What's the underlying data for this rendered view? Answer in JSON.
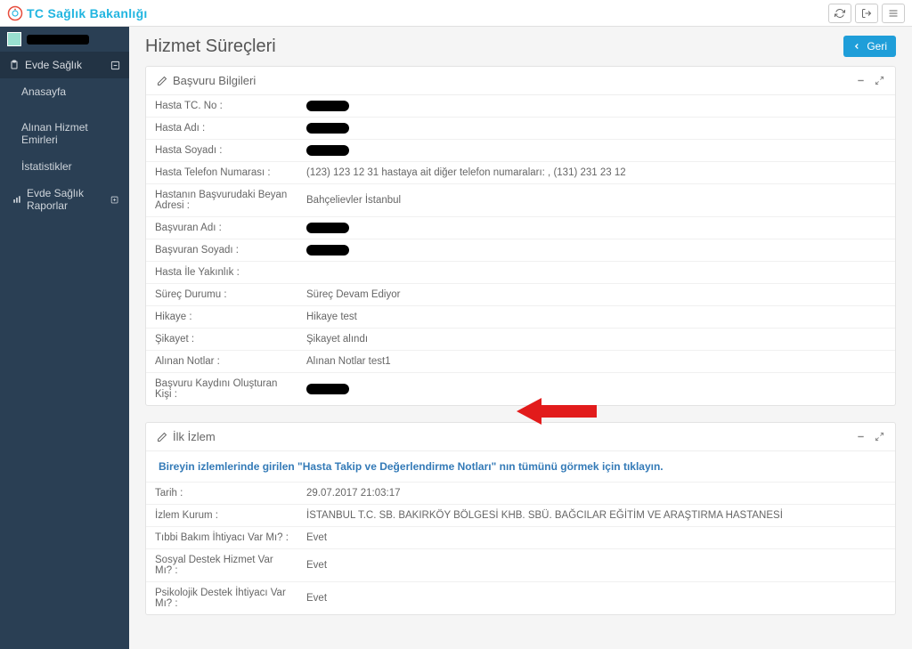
{
  "topbar": {
    "title": "TC Sağlık Bakanlığı"
  },
  "sidebar": {
    "section": "Evde Sağlık",
    "items": [
      "Anasayfa",
      "Alınan Hizmet Emirleri",
      "İstatistikler",
      "Evde Sağlık Raporlar"
    ]
  },
  "page": {
    "title": "Hizmet Süreçleri",
    "back": "Geri"
  },
  "panel1": {
    "title": "Başvuru Bilgileri",
    "rows": [
      {
        "label": "Hasta TC. No :",
        "val": null
      },
      {
        "label": "Hasta Adı :",
        "val": null
      },
      {
        "label": "Hasta Soyadı :",
        "val": null
      },
      {
        "label": "Hasta Telefon Numarası :",
        "val": "(123) 123 12 31 hastaya ait diğer telefon numaraları: , (131) 231 23 12"
      },
      {
        "label": "Hastanın Başvurudaki Beyan Adresi :",
        "val": "Bahçelievler İstanbul"
      },
      {
        "label": "Başvuran Adı :",
        "val": null
      },
      {
        "label": "Başvuran Soyadı :",
        "val": null
      },
      {
        "label": "Hasta İle Yakınlık :",
        "val": ""
      },
      {
        "label": "Süreç Durumu :",
        "val": "Süreç Devam Ediyor"
      },
      {
        "label": "Hikaye :",
        "val": "Hikaye test"
      },
      {
        "label": "Şikayet :",
        "val": "Şikayet alındı"
      },
      {
        "label": "Alınan Notlar :",
        "val": "Alınan Notlar test1"
      },
      {
        "label": "Başvuru Kaydını Oluşturan Kişi :",
        "val": null
      }
    ]
  },
  "panel2": {
    "title": "İlk İzlem",
    "link": "Bireyin izlemlerinde girilen \"Hasta Takip ve Değerlendirme Notları\" nın tümünü görmek için tıklayın.",
    "rows": [
      {
        "label": "Tarih :",
        "val": "29.07.2017 21:03:17"
      },
      {
        "label": "İzlem Kurum :",
        "val": "İSTANBUL T.C. SB. BAKIRKÖY BÖLGESİ KHB. SBÜ. BAĞCILAR EĞİTİM VE ARAŞTIRMA HASTANESİ"
      },
      {
        "label": "Tıbbi Bakım İhtiyacı Var Mı? :",
        "val": "Evet"
      },
      {
        "label": "Sosyal Destek Hizmet Var Mı? :",
        "val": "Evet"
      },
      {
        "label": "Psikolojik Destek İhtiyacı Var Mı? :",
        "val": "Evet"
      }
    ]
  }
}
